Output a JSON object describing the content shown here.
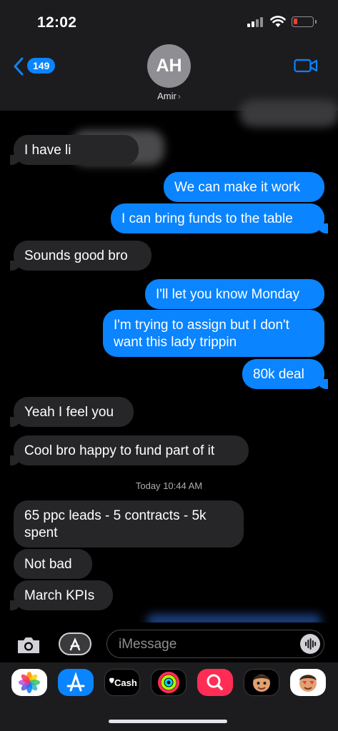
{
  "status_bar": {
    "time": "12:02"
  },
  "header": {
    "back_count": "149",
    "avatar_initials": "AH",
    "contact_name": "Amir",
    "contact_chevron": "›"
  },
  "messages": [
    {
      "dir": "in",
      "text": "I have li"
    },
    {
      "dir": "out",
      "text": "We can make it work"
    },
    {
      "dir": "out",
      "text": "I can bring funds to the table"
    },
    {
      "dir": "in",
      "text": "Sounds good bro"
    },
    {
      "dir": "out",
      "text": "I'll let you know Monday"
    },
    {
      "dir": "out",
      "text": "I'm trying to assign but I don't want this lady trippin"
    },
    {
      "dir": "out",
      "text": "80k deal"
    },
    {
      "dir": "in",
      "text": "Yeah I feel you"
    },
    {
      "dir": "in",
      "text": "Cool bro happy to fund part of it"
    },
    {
      "dir": "in",
      "text": "65 ppc leads - 5 contracts - 5k spent"
    },
    {
      "dir": "in",
      "text": "Not bad"
    },
    {
      "dir": "in",
      "text": "March KPIs"
    }
  ],
  "timestamp": {
    "prefix": "Today",
    "time": "10:44 AM"
  },
  "input_bar": {
    "placeholder": "iMessage"
  },
  "app_drawer": {
    "apps": [
      {
        "icon": "photos-icon"
      },
      {
        "icon": "app-store-icon"
      },
      {
        "icon": "apple-cash-icon",
        "label": "Cash"
      },
      {
        "icon": "activity-icon"
      },
      {
        "icon": "search-images-icon"
      },
      {
        "icon": "memoji-icon"
      },
      {
        "icon": "memoji-stickers-icon"
      }
    ]
  },
  "colors": {
    "accent": "#0a84ff",
    "incoming_bubble": "#262628",
    "header_bg": "#1c1c1e",
    "battery_low": "#ff3b30"
  }
}
